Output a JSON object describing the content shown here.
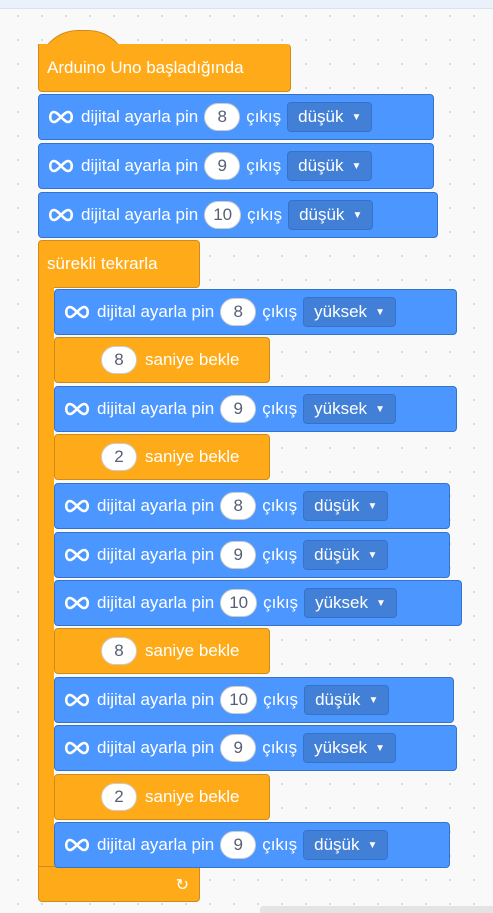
{
  "hat": {
    "label": "Arduino Uno başladığında"
  },
  "setup": [
    {
      "label": "dijital ayarla pin",
      "pin": "8",
      "mid": "çıkış",
      "state": "düşük"
    },
    {
      "label": "dijital ayarla pin",
      "pin": "9",
      "mid": "çıkış",
      "state": "düşük"
    },
    {
      "label": "dijital ayarla pin",
      "pin": "10",
      "mid": "çıkış",
      "state": "düşük"
    }
  ],
  "loop": {
    "label": "sürekli tekrarla",
    "body": [
      {
        "kind": "pin",
        "label": "dijital ayarla pin",
        "pin": "8",
        "mid": "çıkış",
        "state": "yüksek"
      },
      {
        "kind": "wait",
        "value": "8",
        "label": "saniye bekle"
      },
      {
        "kind": "pin",
        "label": "dijital ayarla pin",
        "pin": "9",
        "mid": "çıkış",
        "state": "yüksek"
      },
      {
        "kind": "wait",
        "value": "2",
        "label": "saniye bekle"
      },
      {
        "kind": "pin",
        "label": "dijital ayarla pin",
        "pin": "8",
        "mid": "çıkış",
        "state": "düşük"
      },
      {
        "kind": "pin",
        "label": "dijital ayarla pin",
        "pin": "9",
        "mid": "çıkış",
        "state": "düşük"
      },
      {
        "kind": "pin",
        "label": "dijital ayarla pin",
        "pin": "10",
        "mid": "çıkış",
        "state": "yüksek"
      },
      {
        "kind": "wait",
        "value": "8",
        "label": "saniye bekle"
      },
      {
        "kind": "pin",
        "label": "dijital ayarla pin",
        "pin": "10",
        "mid": "çıkış",
        "state": "düşük"
      },
      {
        "kind": "pin",
        "label": "dijital ayarla pin",
        "pin": "9",
        "mid": "çıkış",
        "state": "yüksek"
      },
      {
        "kind": "wait",
        "value": "2",
        "label": "saniye bekle"
      },
      {
        "kind": "pin",
        "label": "dijital ayarla pin",
        "pin": "9",
        "mid": "çıkış",
        "state": "düşük"
      }
    ]
  },
  "icons": {
    "block_icon": "infinity-icon",
    "loop_icon": "loop-arrow-icon",
    "dropdown_icon": "caret-down-icon"
  },
  "colors": {
    "control": "#ffab19",
    "arduino": "#4c97ff",
    "input": "#ffffff"
  }
}
